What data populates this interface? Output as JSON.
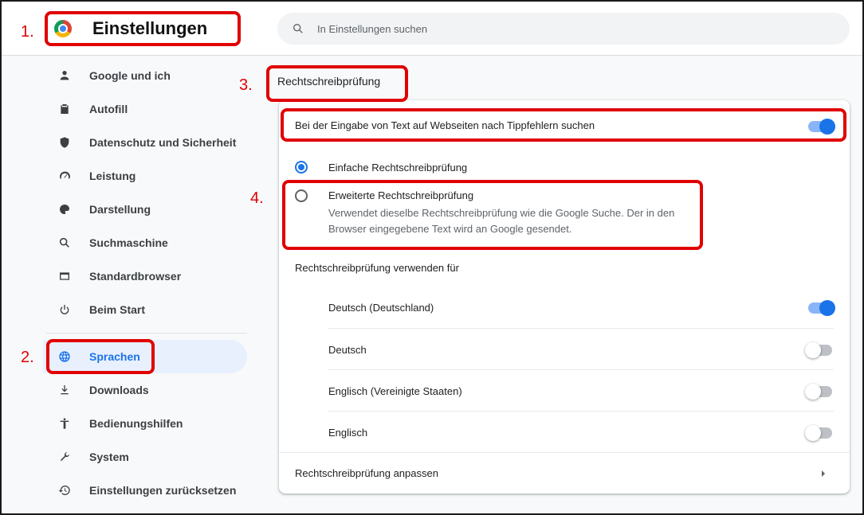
{
  "header": {
    "title": "Einstellungen",
    "search_placeholder": "In Einstellungen suchen"
  },
  "sidebar": {
    "items": [
      {
        "label": "Google und ich",
        "icon": "person-icon"
      },
      {
        "label": "Autofill",
        "icon": "clipboard-icon"
      },
      {
        "label": "Datenschutz und Sicherheit",
        "icon": "shield-icon"
      },
      {
        "label": "Leistung",
        "icon": "speedometer-icon"
      },
      {
        "label": "Darstellung",
        "icon": "palette-icon"
      },
      {
        "label": "Suchmaschine",
        "icon": "search-icon"
      },
      {
        "label": "Standardbrowser",
        "icon": "browser-icon"
      },
      {
        "label": "Beim Start",
        "icon": "power-icon"
      },
      {
        "label": "Sprachen",
        "icon": "globe-icon",
        "active": true
      },
      {
        "label": "Downloads",
        "icon": "download-icon"
      },
      {
        "label": "Bedienungshilfen",
        "icon": "accessibility-icon"
      },
      {
        "label": "System",
        "icon": "wrench-icon"
      },
      {
        "label": "Einstellungen zurücksetzen",
        "icon": "reset-icon"
      }
    ]
  },
  "spellcheck": {
    "section_title": "Rechtschreibprüfung",
    "main_toggle_label": "Bei der Eingabe von Text auf Webseiten nach Tippfehlern suchen",
    "main_toggle_on": true,
    "basic_label": "Einfache Rechtschreibprüfung",
    "basic_selected": true,
    "enhanced_label": "Erweiterte Rechtschreibprüfung",
    "enhanced_desc_1": "Verwendet dieselbe Rechtschreibprüfung wie die Google Suche. Der in den",
    "enhanced_desc_2": "Browser eingegebene Text wird an Google gesendet.",
    "enhanced_selected": false,
    "use_for_label": "Rechtschreibprüfung verwenden für",
    "languages": [
      {
        "label": "Deutsch (Deutschland)",
        "on": true
      },
      {
        "label": "Deutsch",
        "on": false
      },
      {
        "label": "Englisch (Vereinigte Staaten)",
        "on": false
      },
      {
        "label": "Englisch",
        "on": false
      }
    ],
    "customize_label": "Rechtschreibprüfung anpassen"
  },
  "annotations": {
    "n1": "1.",
    "n2": "2.",
    "n3": "3.",
    "n4": "4."
  },
  "colors": {
    "accent": "#1a73e8",
    "annotation_red": "#e00000",
    "active_nav_bg": "#e8f0fe"
  }
}
